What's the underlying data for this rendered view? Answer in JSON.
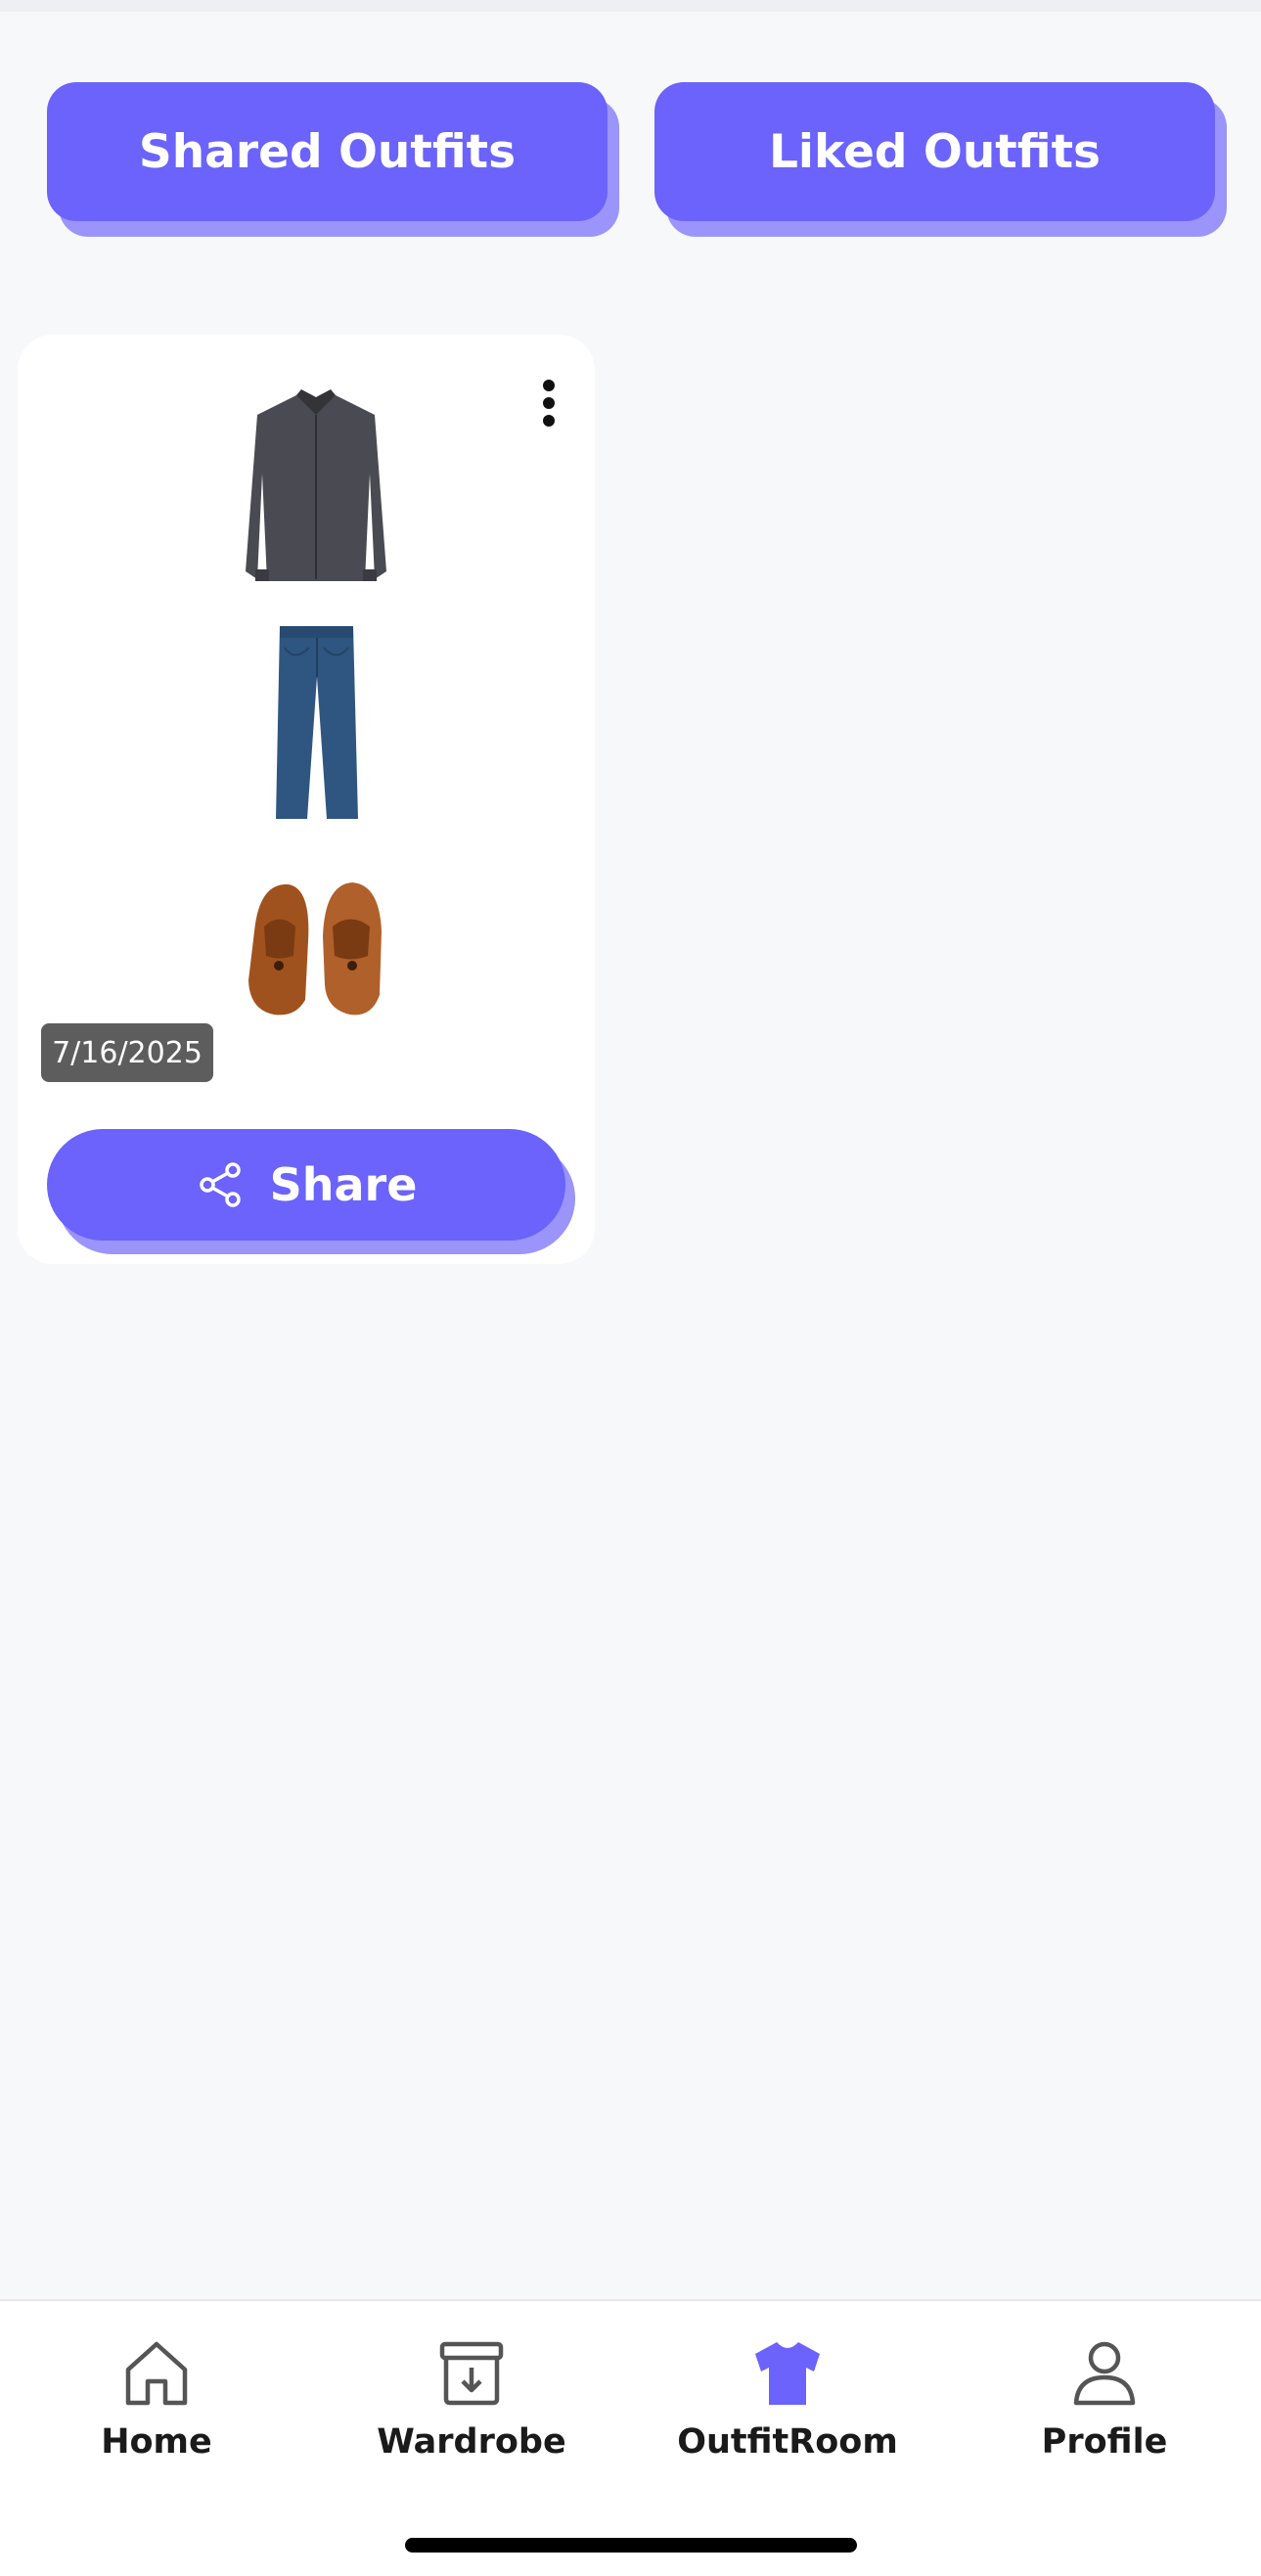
{
  "tabs": {
    "shared_label": "Shared Outfits",
    "liked_label": "Liked Outfits"
  },
  "outfit_card": {
    "date": "7/16/2025",
    "share_label": "Share",
    "items": [
      "shirt-image",
      "pants-image",
      "shoes-image"
    ]
  },
  "bottom_nav": {
    "items": [
      {
        "label": "Home",
        "icon": "home-icon"
      },
      {
        "label": "Wardrobe",
        "icon": "wardrobe-icon"
      },
      {
        "label": "OutfitRoom",
        "icon": "tshirt-icon",
        "active": true
      },
      {
        "label": "Profile",
        "icon": "profile-icon"
      }
    ]
  },
  "colors": {
    "accent": "#6b63fb",
    "accent_shadow": "#9a94fb",
    "background": "#f7f8fa"
  }
}
